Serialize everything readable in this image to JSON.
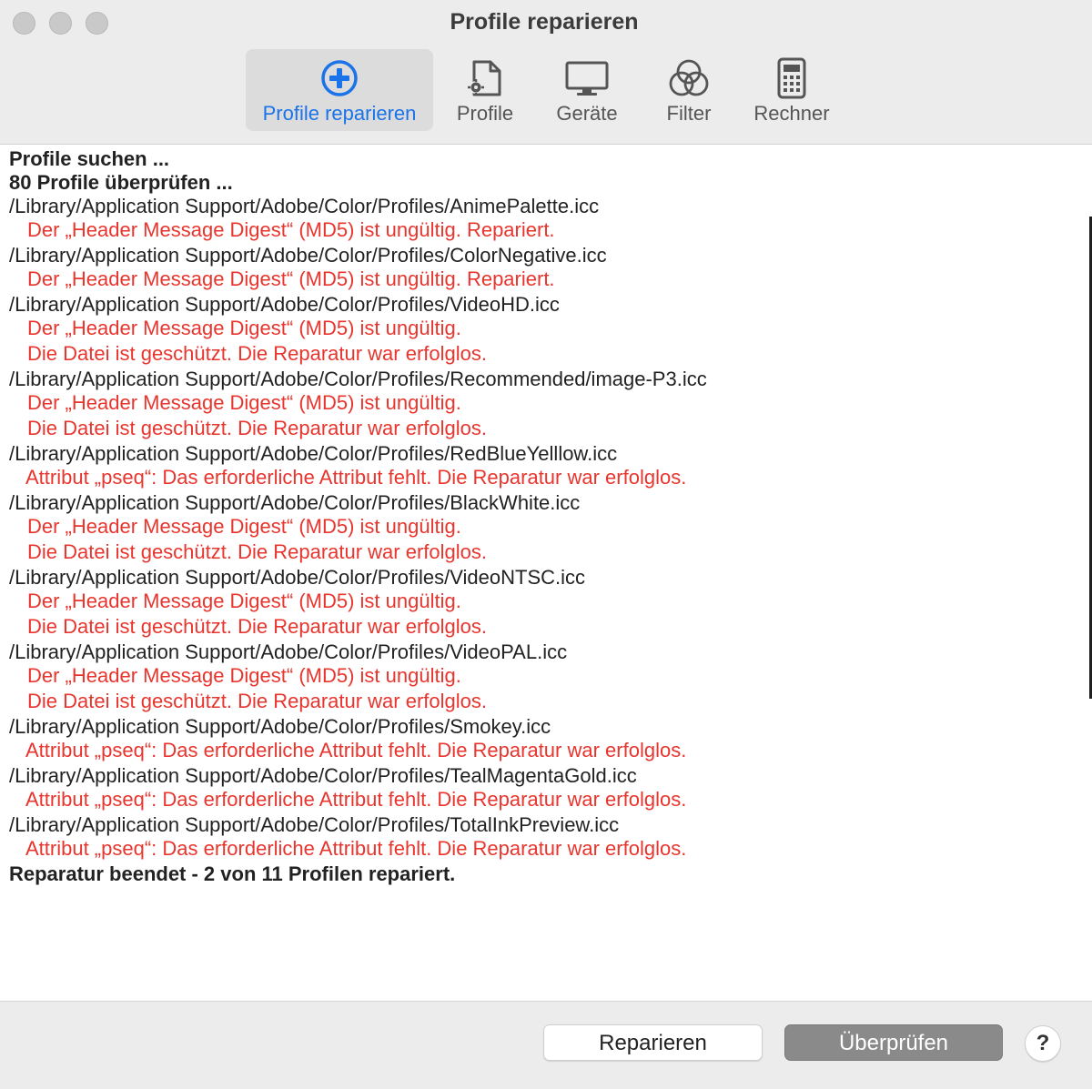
{
  "window": {
    "title": "Profile reparieren"
  },
  "toolbar": {
    "items": [
      {
        "label": "Profile reparieren",
        "icon": "plus-circle-icon",
        "active": true
      },
      {
        "label": "Profile",
        "icon": "document-gear-icon",
        "active": false
      },
      {
        "label": "Geräte",
        "icon": "monitor-icon",
        "active": false
      },
      {
        "label": "Filter",
        "icon": "color-circles-icon",
        "active": false
      },
      {
        "label": "Rechner",
        "icon": "calculator-icon",
        "active": false
      }
    ],
    "accent_color": "#1a73e8"
  },
  "log": {
    "error_color": "#e8352e",
    "lines": [
      "Profile suchen ...",
      "80 Profile überprüfen ...",
      "/Library/Application Support/Adobe/Color/Profiles/AnimePalette.icc",
      "Der „Header Message Digest“ (MD5) ist ungültig. Repariert.",
      "/Library/Application Support/Adobe/Color/Profiles/ColorNegative.icc",
      "Der „Header Message Digest“ (MD5) ist ungültig. Repariert.",
      "/Library/Application Support/Adobe/Color/Profiles/VideoHD.icc",
      "Der „Header Message Digest“ (MD5) ist ungültig.",
      "Die Datei ist geschützt. Die Reparatur war erfolglos.",
      "/Library/Application Support/Adobe/Color/Profiles/Recommended/image-P3.icc",
      "Der „Header Message Digest“ (MD5) ist ungültig.",
      "Die Datei ist geschützt. Die Reparatur war erfolglos.",
      "/Library/Application Support/Adobe/Color/Profiles/RedBlueYelllow.icc",
      "Attribut „pseq“: Das erforderliche Attribut fehlt. Die Reparatur war erfolglos.",
      "/Library/Application Support/Adobe/Color/Profiles/BlackWhite.icc",
      "Der „Header Message Digest“ (MD5) ist ungültig.",
      "Die Datei ist geschützt. Die Reparatur war erfolglos.",
      "/Library/Application Support/Adobe/Color/Profiles/VideoNTSC.icc",
      "Der „Header Message Digest“ (MD5) ist ungültig.",
      "Die Datei ist geschützt. Die Reparatur war erfolglos.",
      "/Library/Application Support/Adobe/Color/Profiles/VideoPAL.icc",
      "Der „Header Message Digest“ (MD5) ist ungültig.",
      "Die Datei ist geschützt. Die Reparatur war erfolglos.",
      "/Library/Application Support/Adobe/Color/Profiles/Smokey.icc",
      "Attribut „pseq“: Das erforderliche Attribut fehlt. Die Reparatur war erfolglos.",
      "/Library/Application Support/Adobe/Color/Profiles/TealMagentaGold.icc",
      "Attribut „pseq“: Das erforderliche Attribut fehlt. Die Reparatur war erfolglos.",
      "/Library/Application Support/Adobe/Color/Profiles/TotalInkPreview.icc",
      "Attribut „pseq“: Das erforderliche Attribut fehlt. Die Reparatur war erfolglos.",
      "Reparatur beendet - 2 von 11 Profilen repariert."
    ]
  },
  "footer": {
    "repair_label": "Reparieren",
    "check_label": "Überprüfen",
    "help_label": "?"
  }
}
